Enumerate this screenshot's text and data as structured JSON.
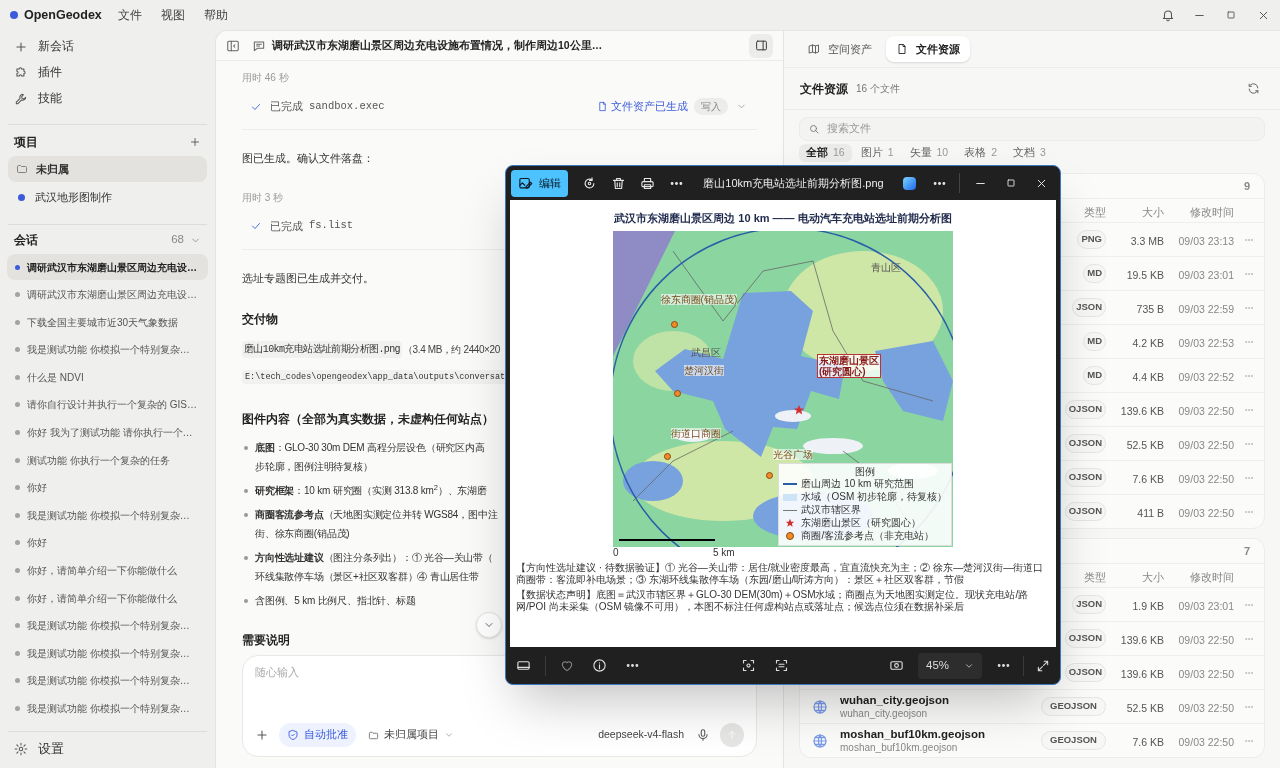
{
  "app": {
    "name": "OpenGeodex",
    "menu": [
      "文件",
      "视图",
      "帮助"
    ]
  },
  "sidebar": {
    "actions": [
      {
        "kind": "new",
        "label": "新会话"
      },
      {
        "kind": "plugin",
        "label": "插件"
      },
      {
        "kind": "skill",
        "label": "技能"
      }
    ],
    "projects": {
      "title": "项目",
      "items": [
        {
          "kind": "folder",
          "label": "未归属",
          "selected": true
        },
        {
          "kind": "dot",
          "label": "武汉地形图制作",
          "selected": false
        }
      ]
    },
    "sessions": {
      "title": "会话",
      "count": "68",
      "expanded": true,
      "items": [
        {
          "label": "调研武汉市东湖磨山景区周边充电设…",
          "selected": true
        },
        {
          "label": "调研武汉市东湖磨山景区周边充电设…",
          "selected": false
        },
        {
          "label": "下载全国主要城市近30天气象数据",
          "selected": false
        },
        {
          "label": "我是测试功能 你模拟一个特别复杂…",
          "selected": false
        },
        {
          "label": "什么是 NDVI",
          "selected": false
        },
        {
          "label": "请你自行设计并执行一个复杂的 GIS…",
          "selected": false
        },
        {
          "label": "你好 我为了测试功能 请你执行一个…",
          "selected": false
        },
        {
          "label": "测试功能 你执行一个复杂的任务",
          "selected": false
        },
        {
          "label": "你好",
          "selected": false
        },
        {
          "label": "我是测试功能 你模拟一个特别复杂…",
          "selected": false
        },
        {
          "label": "你好",
          "selected": false
        },
        {
          "label": "你好，请简单介绍一下你能做什么",
          "selected": false
        },
        {
          "label": "你好，请简单介绍一下你能做什么",
          "selected": false
        },
        {
          "label": "我是测试功能 你模拟一个特别复杂…",
          "selected": false
        },
        {
          "label": "我是测试功能 你模拟一个特别复杂…",
          "selected": false
        },
        {
          "label": "我是测试功能 你模拟一个特别复杂…",
          "selected": false
        },
        {
          "label": "我是测试功能 你模拟一个特别复杂…",
          "selected": false
        }
      ]
    },
    "settings": "设置"
  },
  "chat": {
    "title": "调研武汉市东湖磨山景区周边充电设施布置情况，制作周边10公里…",
    "blocks": [
      {
        "kind": "meta",
        "text": "用时 46 秒"
      },
      {
        "kind": "tool",
        "status": "已完成",
        "command": "sandbox.exec",
        "asset": "文件资产已生成",
        "badge": "写入"
      },
      {
        "kind": "text",
        "text": "图已生成。确认文件落盘："
      },
      {
        "kind": "meta",
        "text": "用时 3 秒"
      },
      {
        "kind": "tool",
        "status": "已完成",
        "command": "fs.list"
      },
      {
        "kind": "text",
        "text": "选址专题图已生成并交付。"
      },
      {
        "kind": "heading",
        "text": "交付物"
      },
      {
        "kind": "file",
        "code": "磨山10km充电站选址前期分析图.png",
        "text": "（3.4 MB，约 2440×20"
      },
      {
        "kind": "path",
        "code": "E:\\tech_codes\\opengeodex\\app_data\\outputs\\conversat"
      },
      {
        "kind": "heading",
        "text": "图件内容（全部为真实数据，未虚构任何站点）"
      },
      {
        "kind": "bullets",
        "items": [
          {
            "lines": [
              "**底图**：GLO-30 30m DEM 高程分层设色（研究区内高",
              "步轮廓，图例注明待复核）"
            ]
          },
          {
            "lines": [
              "**研究框架**：10 km 研究圈（实测 313.8 km$^{2}$）、东湖磨"
            ]
          },
          {
            "lines": [
              "**商圈客流参考点**（天地图实测定位并转 WGS84，图中注",
              "街、徐东商圈(销品茂)"
            ]
          },
          {
            "lines": [
              "**方向性选址建议**（图注分条列出）：① 光谷—关山带（",
              "环线集散停车场（景区+社区双客群）④ 青山居住带"
            ]
          },
          {
            "lines": [
              "含图例、5 km 比例尺、指北针、标题"
            ]
          }
        ]
      },
      {
        "kind": "heading",
        "text": "需要说明"
      }
    ],
    "composer": {
      "placeholder": "随心输入",
      "auto_approve": {
        "label": "自动批准",
        "on": true
      },
      "project": "未归属项目",
      "model": "deepseek-v4-flash"
    }
  },
  "files_panel": {
    "tabs": [
      {
        "kind": "map",
        "label": "空间资产",
        "selected": false
      },
      {
        "kind": "file",
        "label": "文件资源",
        "selected": true
      }
    ],
    "title": "文件资源",
    "count": "16 个文件",
    "search_placeholder": "搜索文件",
    "filters": [
      {
        "label": "全部",
        "count": "16",
        "selected": true
      },
      {
        "label": "图片",
        "count": "1",
        "selected": false
      },
      {
        "label": "矢量",
        "count": "10",
        "selected": false
      },
      {
        "label": "表格",
        "count": "2",
        "selected": false
      },
      {
        "label": "文档",
        "count": "3",
        "selected": false
      }
    ],
    "groups": [
      {
        "count": "9",
        "columns": [
          "类型",
          "大小",
          "修改时间"
        ],
        "rows": [
          {
            "type": "PNG",
            "size": "3.3 MB",
            "modified": "09/03 23:13"
          },
          {
            "type": "MD",
            "size": "19.5 KB",
            "modified": "09/03 23:01"
          },
          {
            "type": "JSON",
            "size": "735 B",
            "modified": "09/03 22:59"
          },
          {
            "type": "MD",
            "size": "4.2 KB",
            "modified": "09/03 22:53"
          },
          {
            "type": "MD",
            "size": "4.4 KB",
            "modified": "09/03 22:52"
          },
          {
            "type": "OJSON",
            "size": "139.6 KB",
            "modified": "09/03 22:50"
          },
          {
            "type": "OJSON",
            "size": "52.5 KB",
            "modified": "09/03 22:50"
          },
          {
            "type": "OJSON",
            "size": "7.6 KB",
            "modified": "09/03 22:50"
          },
          {
            "type": "OJSON",
            "size": "411 B",
            "modified": "09/03 22:50"
          }
        ]
      },
      {
        "count": "7",
        "columns": [
          "类型",
          "大小",
          "修改时间"
        ],
        "rows": [
          {
            "type": "JSON",
            "size": "1.9 KB",
            "modified": "09/03 23:01"
          },
          {
            "type": "OJSON",
            "size": "139.6 KB",
            "modified": "09/03 22:50"
          },
          {
            "type": "OJSON",
            "size": "139.6 KB",
            "modified": "09/03 22:50"
          },
          {
            "name": "wuhan_city.geojson",
            "path": "wuhan_city.geojson",
            "type": "GEOJSON",
            "size": "52.5 KB",
            "modified": "09/03 22:50"
          },
          {
            "name": "moshan_buf10km.geojson",
            "path": "moshan_buf10km.geojson",
            "type": "GEOJSON",
            "size": "7.6 KB",
            "modified": "09/03 22:50"
          }
        ]
      }
    ]
  },
  "viewer": {
    "title": "磨山10km充电站选址前期分析图.png",
    "edit_label": "编辑",
    "zoom": "45%",
    "image": {
      "title": "武汉市东湖磨山景区周边 10 km —— 电动汽车充电站选址前期分析图",
      "labels": [
        {
          "kind": "district",
          "text": "青山区"
        },
        {
          "kind": "poi",
          "text": "徐东商圈(销品茂)"
        },
        {
          "kind": "district",
          "text": "武昌区"
        },
        {
          "kind": "poi",
          "text": "楚河汉街"
        },
        {
          "kind": "center",
          "text": "东湖磨山景区\n(研究圆心)"
        },
        {
          "kind": "poi",
          "text": "街道口商圈"
        },
        {
          "kind": "poi",
          "text": "光谷广场"
        }
      ],
      "legend": {
        "title": "图例",
        "items": [
          {
            "kind": "line",
            "text": "磨山周边 10 km 研究范围"
          },
          {
            "kind": "fill",
            "text": "水域（OSM 初步轮廓，待复核）"
          },
          {
            "kind": "boundary",
            "text": "武汉市辖区界"
          },
          {
            "kind": "star",
            "text": "东湖磨山景区（研究圆心）"
          },
          {
            "kind": "dot",
            "text": "商圈/客流参考点（非充电站）"
          }
        ]
      },
      "scale": [
        "0",
        "5 km"
      ],
      "notes": [
        "【方向性选址建议 · 待数据验证】① 光谷—关山带：居住/就业密度最高，宜直流快充为主；② 徐东—楚河汉街—街道口商圈带：客流即补电场景；③ 东湖环线集散停车场（东园/磨山/听涛方向）：景区＋社区双客群，节假",
        "【数据状态声明】底图＝武汉市辖区界＋GLO-30 DEM(30m)＋OSM水域；商圈点为天地图实测定位。现状充电站/路网/POI 尚未采集（OSM 镜像不可用），本图不标注任何虚构站点或落址点；候选点位须在数据补采后"
      ]
    }
  }
}
